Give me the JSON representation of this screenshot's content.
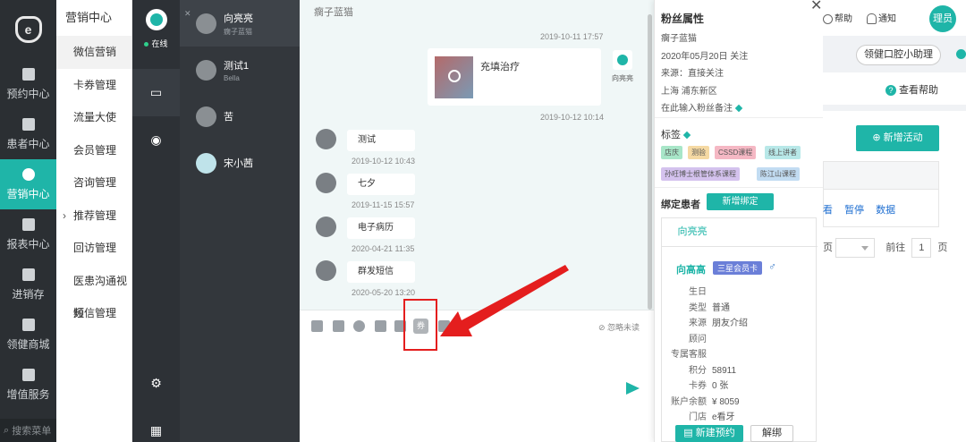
{
  "nav": {
    "items": [
      {
        "label": "预约中心",
        "icon": "calendar-icon"
      },
      {
        "label": "患者中心",
        "icon": "user-icon"
      },
      {
        "label": "营销中心",
        "icon": "fan-icon",
        "active": true
      },
      {
        "label": "报表中心",
        "icon": "chart-icon"
      },
      {
        "label": "进销存",
        "icon": "layers-icon"
      },
      {
        "label": "领健商城",
        "icon": "shop-icon"
      },
      {
        "label": "增值服务",
        "icon": "grid-icon"
      }
    ],
    "search_label": "搜索菜单"
  },
  "submenu": {
    "title": "营销中心",
    "items": [
      {
        "label": "微信营销",
        "active": true
      },
      {
        "label": "卡券管理"
      },
      {
        "label": "流量大使"
      },
      {
        "label": "会员管理"
      },
      {
        "label": "咨询管理"
      },
      {
        "label": "推荐管理",
        "caret": "›"
      },
      {
        "label": "回访管理"
      },
      {
        "label": "医患沟通视频"
      },
      {
        "label": "短信管理"
      }
    ]
  },
  "chat_rail": {
    "status": "在线"
  },
  "conversations": [
    {
      "name": "向亮亮",
      "sub": "瘸子蓝猫",
      "active": true
    },
    {
      "name": "测试1",
      "sub": "Bella"
    },
    {
      "name": "苦",
      "sub": ""
    },
    {
      "name": "宋小茜",
      "sub": ""
    }
  ],
  "chat": {
    "header": "瘸子蓝猫",
    "ts1": "2019-10-11 17:57",
    "card_title": "充填治疗",
    "sender_name": "向亮亮",
    "ts2": "2019-10-12 10:14",
    "messages": [
      {
        "text": "测试",
        "time": "2019-10-12 10:43"
      },
      {
        "text": "七夕",
        "time": "2019-11-15 15:57"
      },
      {
        "text": "电子病历",
        "time": "2020-04-21 11:35"
      },
      {
        "text": "群发短信",
        "time": "2020-05-20 13:20"
      }
    ],
    "coupon_label": "券",
    "ignore_unread": "忽略未读"
  },
  "fan": {
    "title": "粉丝属性",
    "nickname": "瘸子蓝猫",
    "followed": "2020年05月20日 关注",
    "source": "来源：直接关注",
    "region": "上海 浦东新区",
    "note_placeholder": "在此输入粉丝备注",
    "tags_label": "标签",
    "tags": [
      {
        "label": "店庆",
        "color": "#a8e6c8"
      },
      {
        "label": "测验",
        "color": "#f5d9a3"
      },
      {
        "label": "CSSD课程",
        "color": "#f5b8c4"
      },
      {
        "label": "线上讲者",
        "color": "#b8e8e8"
      },
      {
        "label": "孙旺博士根管体系课程",
        "color": "#d4c2ee"
      },
      {
        "label": "陈江山课程",
        "color": "#c2dcf2"
      }
    ],
    "bind_label": "绑定患者",
    "bind_button": "新增绑定",
    "patient_tab": "向亮亮",
    "patient_name": "向高高",
    "member_badge": "三星会员卡",
    "gender_symbol": "♂",
    "fields": [
      {
        "k": "生日",
        "v": ""
      },
      {
        "k": "类型",
        "v": "普通"
      },
      {
        "k": "来源",
        "v": "朋友介绍"
      },
      {
        "k": "顾问",
        "v": ""
      },
      {
        "k": "专属客服",
        "v": ""
      },
      {
        "k": "积分",
        "v": "58911"
      },
      {
        "k": "卡券",
        "v": "0 张"
      },
      {
        "k": "账户余额",
        "v": "¥ 8059"
      },
      {
        "k": "门店",
        "v": "e看牙"
      }
    ],
    "new_appointment": "新建预约",
    "unbind": "解绑"
  },
  "topbar": {
    "help": "帮助",
    "notify": "通知",
    "user": "理员",
    "assistant": "领健口腔小助理",
    "view_help": "查看帮助",
    "add_activity": "新增活动",
    "ops": [
      "看",
      "暂停",
      "数据"
    ],
    "page_goto": "前往",
    "page_num": "1",
    "page_unit": "页",
    "page_suffix": "页"
  },
  "colors": {
    "accent": "#1fb5a8",
    "highlight": "#e41e1e"
  }
}
